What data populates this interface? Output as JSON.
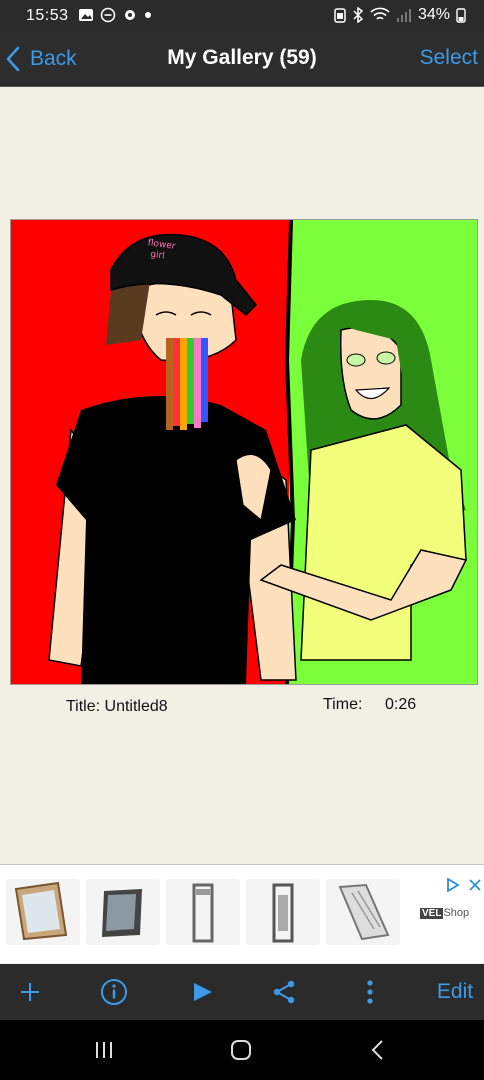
{
  "status_bar": {
    "time": "15:53",
    "battery": "34%",
    "left_icons": [
      "gallery-icon",
      "dnd-icon",
      "settings-icon",
      "dot-icon"
    ],
    "right_icons": [
      "battery-saver-icon",
      "bluetooth-icon",
      "wifi-icon",
      "signal-icon",
      "battery-icon"
    ]
  },
  "nav": {
    "back_label": "Back",
    "title": "My Gallery (59)",
    "select_label": "Select"
  },
  "artwork": {
    "hat_text": "flower\ngirl",
    "colors": {
      "left_bg": "#ff0000",
      "right_bg": "#7aff3a",
      "shirt_left": "#000000",
      "shirt_right": "#f2ff7a",
      "hair_right": "#2a8a14"
    }
  },
  "meta": {
    "title_label": "Title: Untitled8",
    "time_label": "Time:",
    "time_value": "0:26"
  },
  "ad": {
    "logo_brand": "VEL",
    "logo_text": "Shop",
    "items": [
      "window-product-1",
      "window-product-2",
      "window-product-3",
      "window-product-4",
      "window-product-5"
    ]
  },
  "toolbar": {
    "edit_label": "Edit",
    "accent": "#3b9be8"
  }
}
